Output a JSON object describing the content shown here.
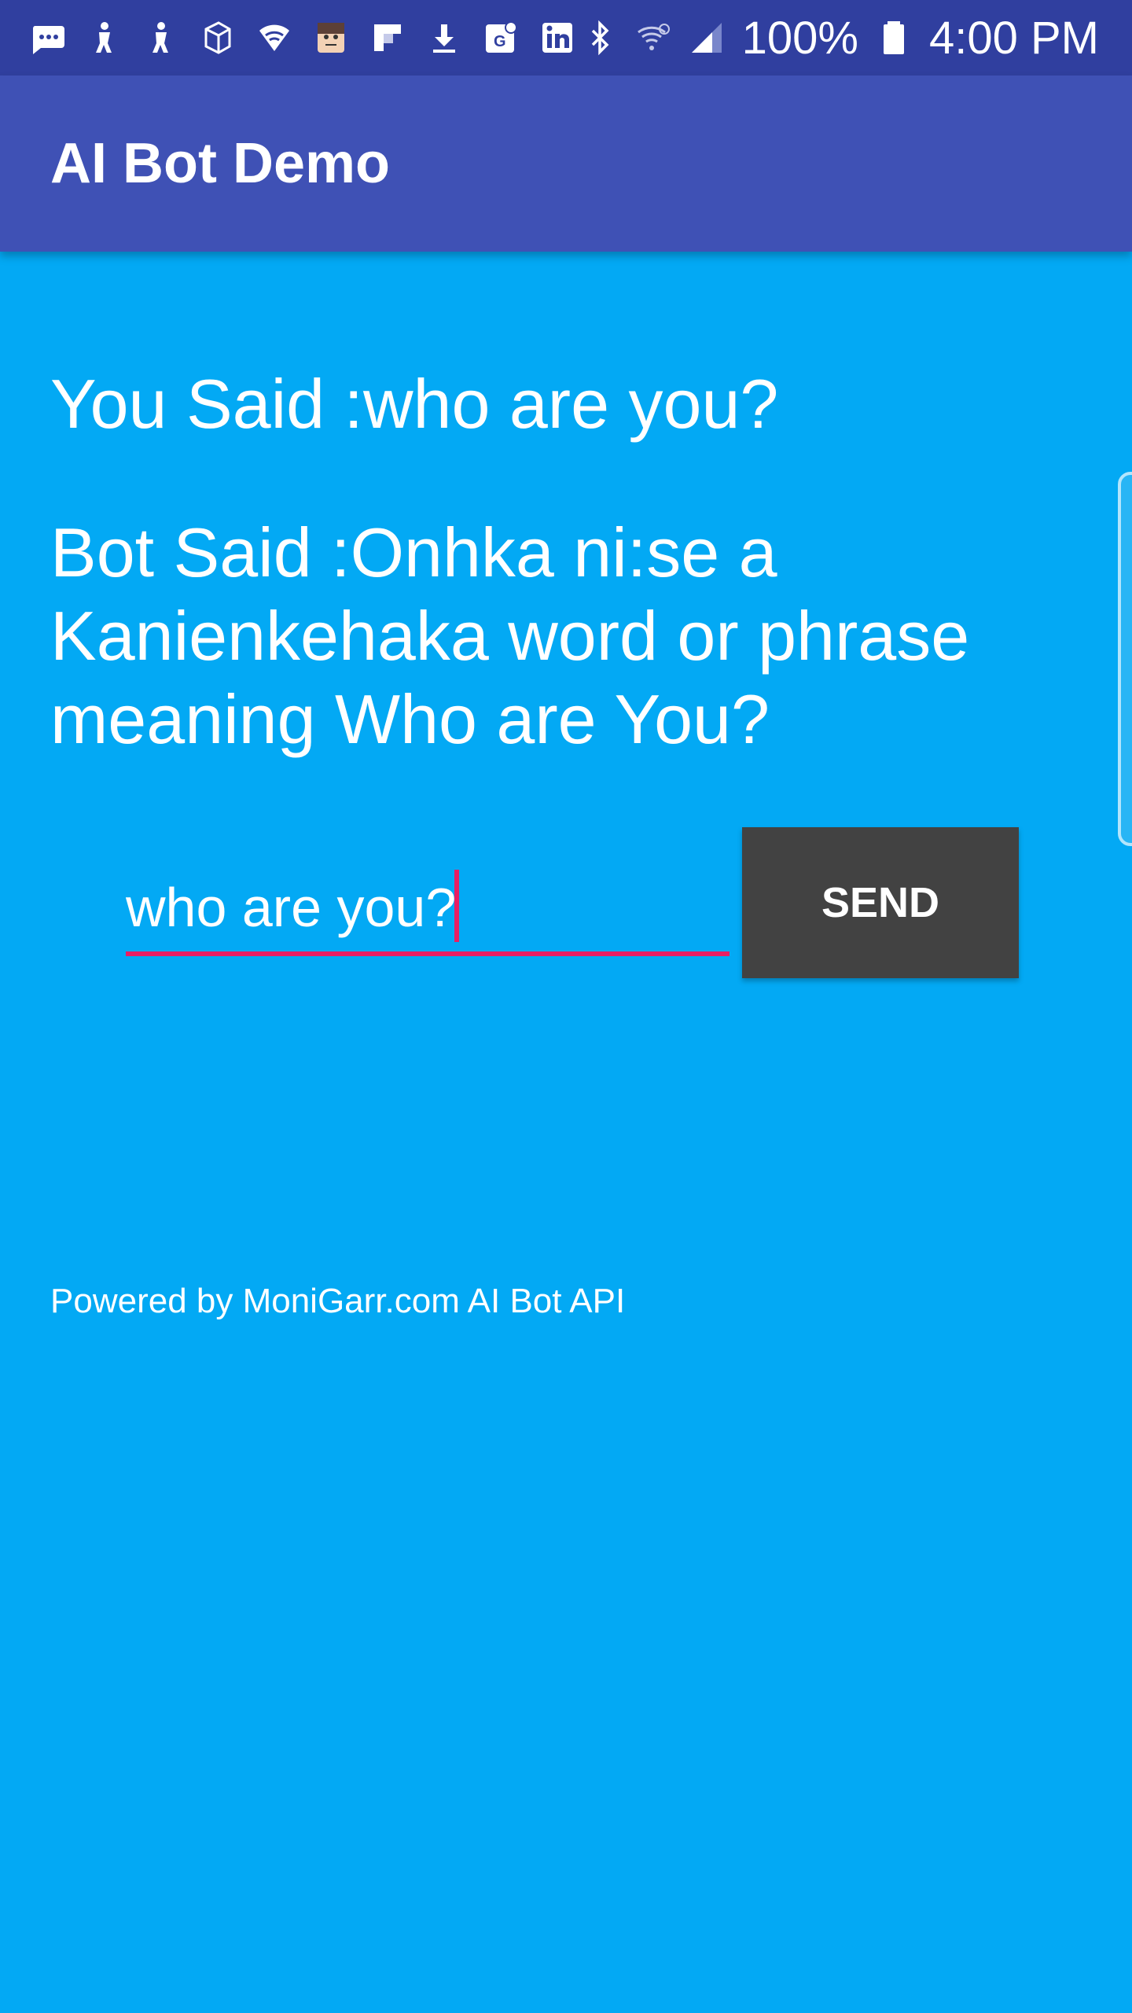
{
  "status_bar": {
    "battery_percent": "100%",
    "time": "4:00 PM",
    "left_icons": [
      "messages-icon",
      "figure-icon",
      "figure-icon-2",
      "cube-icon",
      "shield-wifi-icon",
      "avatar-icon",
      "flipboard-icon",
      "download-icon",
      "maps-icon",
      "linkedin-icon"
    ],
    "right_icons": [
      "bluetooth-icon",
      "wifi-icon",
      "signal-icon",
      "battery-icon"
    ]
  },
  "app_bar": {
    "title": "AI Bot Demo"
  },
  "conversation": {
    "you_said": "You Said :who are you?",
    "bot_said": "Bot Said :Onhka ni:se a Kanienkehaka word or phrase meaning Who are You?"
  },
  "input": {
    "value": "who are you?"
  },
  "send_button": {
    "label": "SEND"
  },
  "footer": {
    "powered_by": "Powered by MoniGarr.com AI Bot API"
  },
  "colors": {
    "status_bar": "#303F9F",
    "app_bar": "#3F51B5",
    "background": "#03A9F4",
    "accent": "#E91E63",
    "button": "#424242"
  }
}
